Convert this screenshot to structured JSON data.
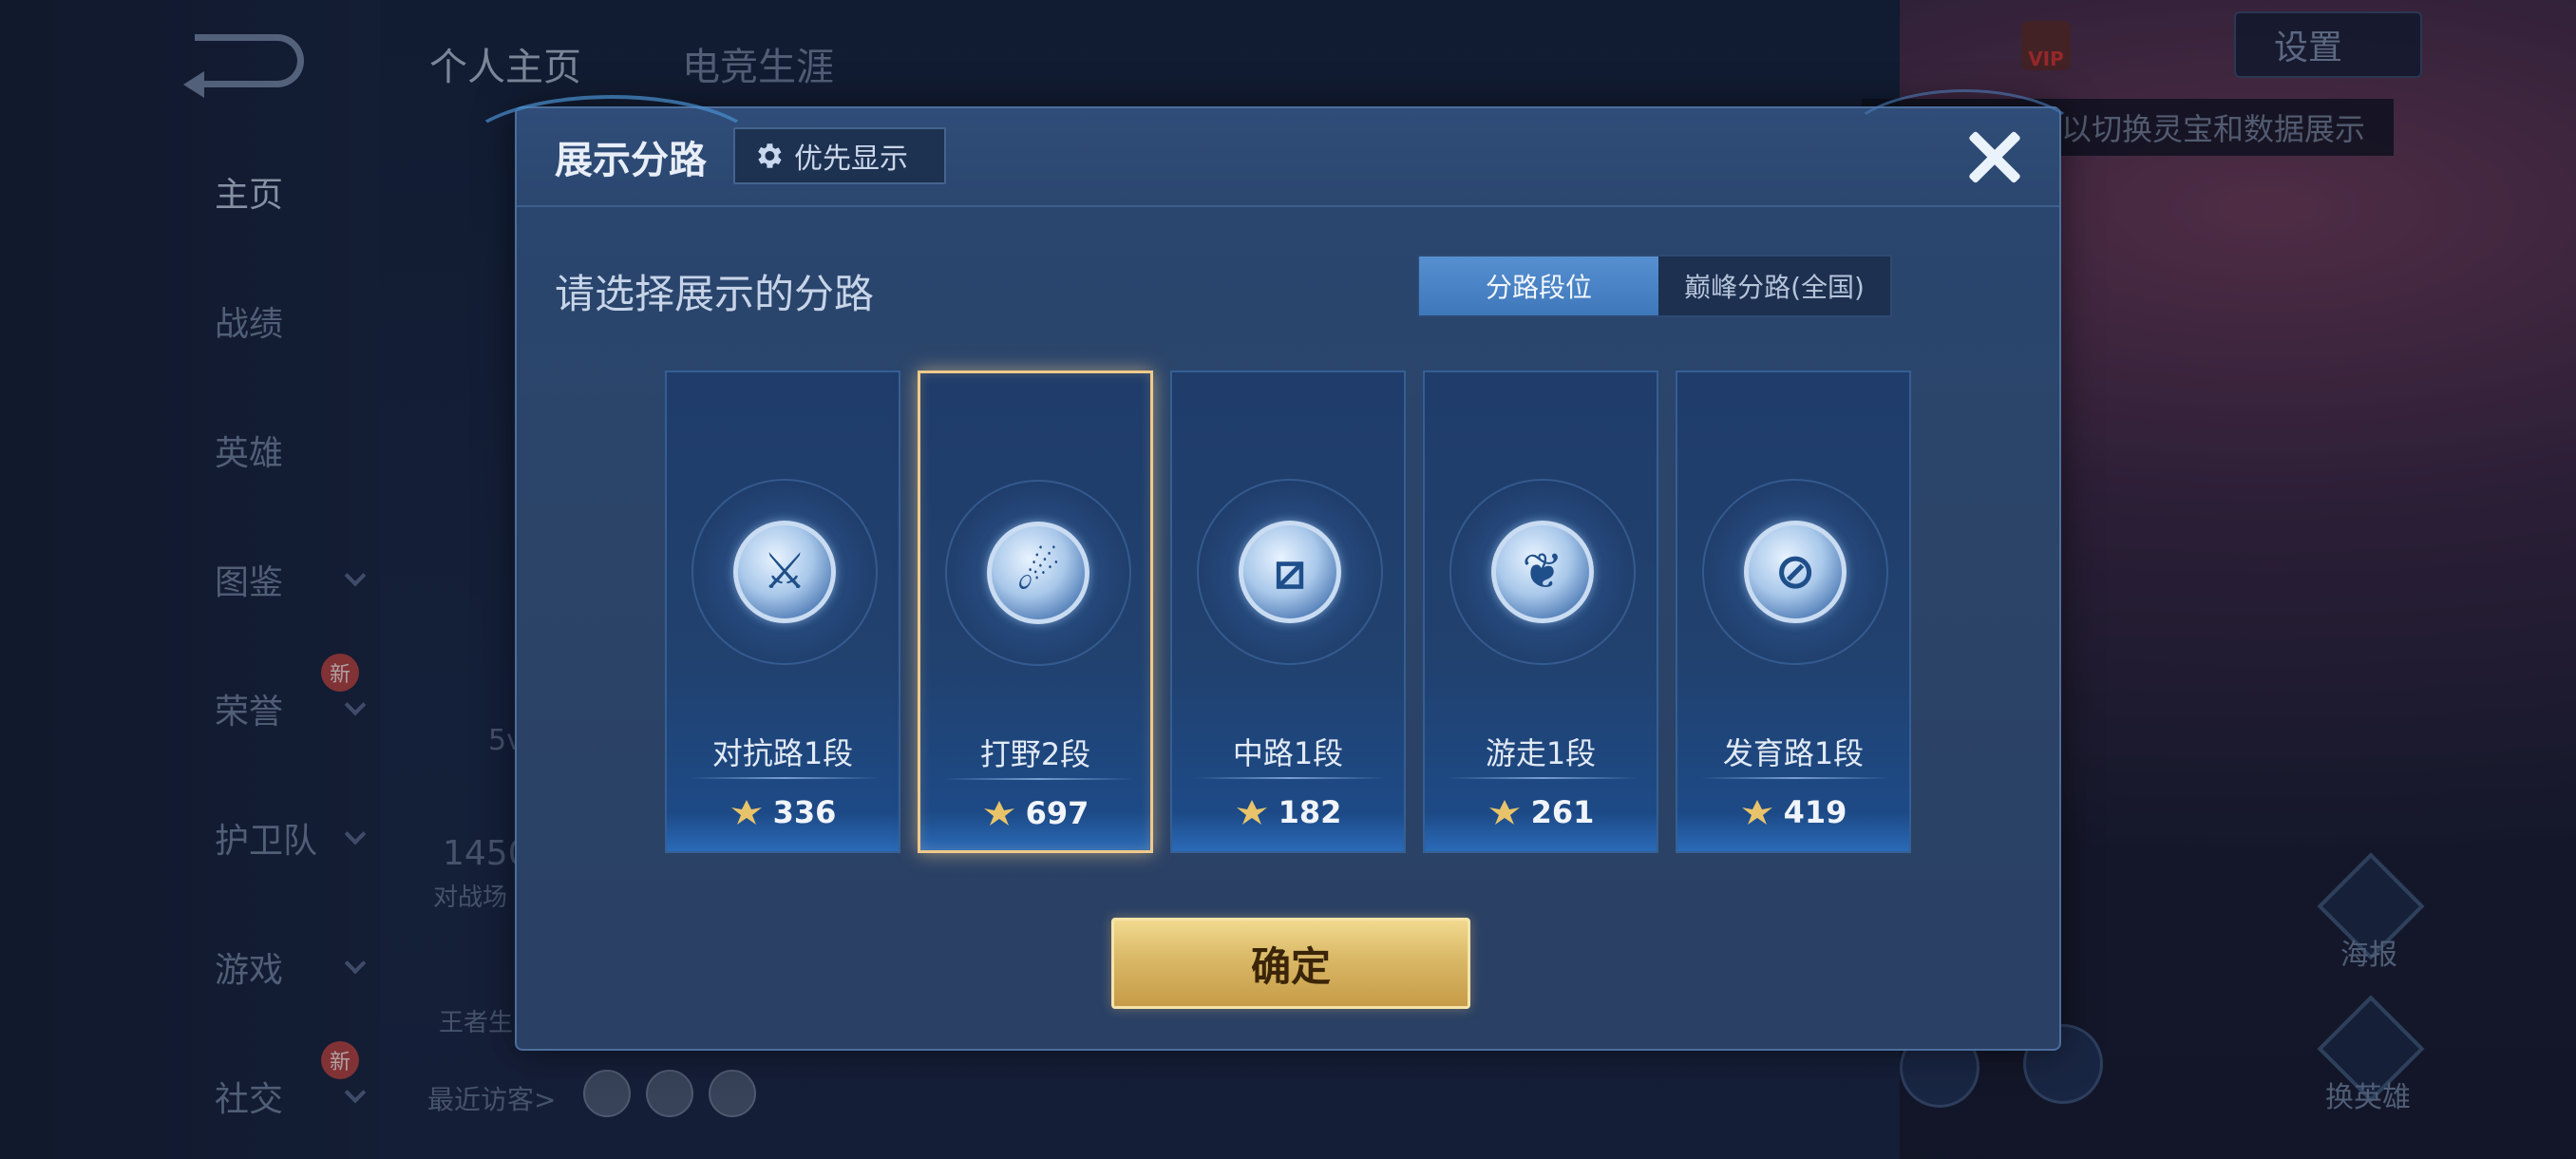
{
  "background": {
    "top_tabs": [
      "个人主页",
      "电竞生涯"
    ],
    "nav": [
      {
        "label": "主页",
        "active": true,
        "chevron": false,
        "new": false
      },
      {
        "label": "战绩",
        "active": false,
        "chevron": false,
        "new": false
      },
      {
        "label": "英雄",
        "active": false,
        "chevron": false,
        "new": false
      },
      {
        "label": "图鉴",
        "active": false,
        "chevron": true,
        "new": false
      },
      {
        "label": "荣誉",
        "active": false,
        "chevron": true,
        "new": true
      },
      {
        "label": "护卫队",
        "active": false,
        "chevron": true,
        "new": false
      },
      {
        "label": "游戏",
        "active": false,
        "chevron": true,
        "new": false
      },
      {
        "label": "社交",
        "active": false,
        "chevron": true,
        "new": true
      }
    ],
    "new_badge_text": "新",
    "settings_label": "设置",
    "vip_label": "VIP",
    "hint_text": "以切换灵宝和数据展示",
    "recent_visitors_label": "最近访客>",
    "partial_texts": [
      "5v",
      "1450",
      "对战场",
      "王者生"
    ],
    "right_labels": [
      "海报",
      "换英雄"
    ]
  },
  "modal": {
    "title": "展示分路",
    "priority_label": "优先显示",
    "section_title": "请选择展示的分路",
    "tabs": [
      {
        "label": "分路段位",
        "active": true
      },
      {
        "label": "巅峰分路(全国)",
        "active": false
      }
    ],
    "cards": [
      {
        "label": "对抗路1段",
        "score": "336",
        "icon": "sword-role-icon",
        "selected": false
      },
      {
        "label": "打野2段",
        "score": "697",
        "icon": "jungle-role-icon",
        "selected": true
      },
      {
        "label": "中路1段",
        "score": "182",
        "icon": "mid-role-icon",
        "selected": false
      },
      {
        "label": "游走1段",
        "score": "261",
        "icon": "roam-role-icon",
        "selected": false
      },
      {
        "label": "发育路1段",
        "score": "419",
        "icon": "adc-role-icon",
        "selected": false
      }
    ],
    "confirm_label": "确定"
  },
  "colors": {
    "accent_blue": "#4a86c8",
    "selected_gold": "#f0c98a",
    "confirm_gold": "#d9b866"
  }
}
